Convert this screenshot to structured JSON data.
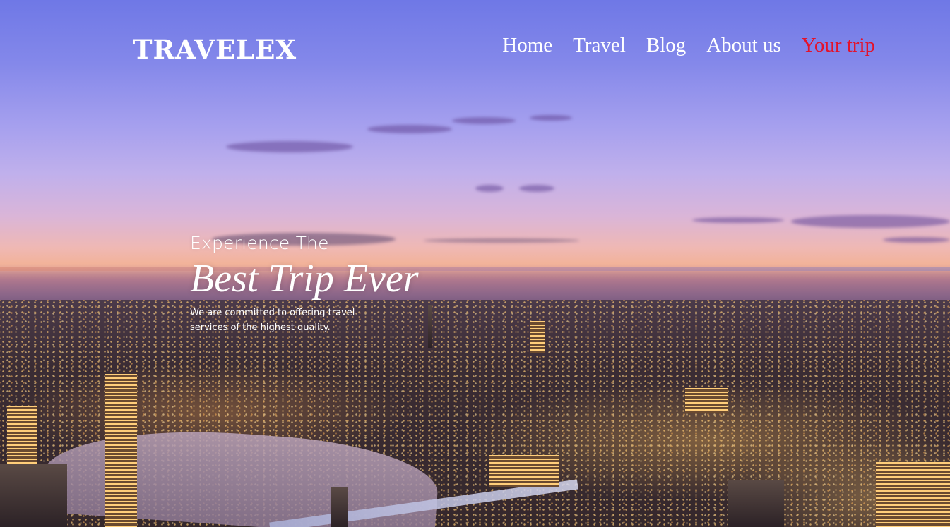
{
  "brand": {
    "logo": "TRAVELEX"
  },
  "nav": {
    "items": [
      {
        "label": "Home",
        "active": false
      },
      {
        "label": "Travel",
        "active": false
      },
      {
        "label": "Blog",
        "active": false
      },
      {
        "label": "About us",
        "active": false
      },
      {
        "label": "Your trip",
        "active": true
      }
    ]
  },
  "hero": {
    "kicker": "Experience The",
    "title": "Best Trip Ever",
    "subtitle": "We are committed to offering travel services of the highest quality."
  },
  "colors": {
    "nav_text": "#ffffff",
    "nav_active": "#e3122a",
    "logo": "#ffffff"
  }
}
